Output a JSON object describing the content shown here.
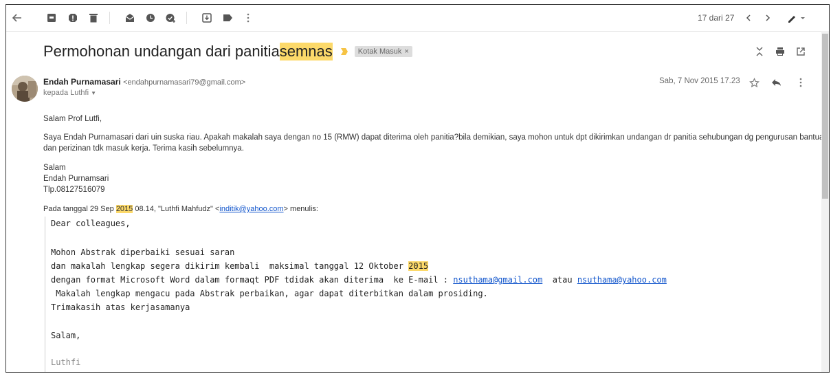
{
  "toolbar": {
    "counter": "17 dari 27",
    "icons": [
      "back-arrow-icon",
      "archive-icon",
      "report-spam-icon",
      "delete-icon",
      "mark-unread-icon",
      "snooze-icon",
      "add-task-icon",
      "move-to-icon",
      "labels-icon",
      "more-vert-icon",
      "prev-icon",
      "next-icon",
      "pen-icon"
    ]
  },
  "subject": {
    "text_before": "Permohonan undangan dari panitia ",
    "highlight": "semnas",
    "label": "Kotak Masuk",
    "label_close": "×"
  },
  "message": {
    "sender_name": "Endah Purnamasari",
    "sender_email": "<endahpurnamasari79@gmail.com>",
    "to_line": "kepada Luthfi",
    "date": "Sab, 7 Nov 2015 17.23",
    "greeting": "Salam Prof Lutfi,",
    "para1_line1": "Saya Endah Purnamasari dari uin suska riau. Apakah makalah saya dengan no 15 (RMW) dapat diterima oleh panitia?bila demikian, saya mohon untuk dpt dikirimkan undangan dr panitia sehubungan dg pengurusan bantuan",
    "para1_line2": "dan perizinan tdk masuk kerja. Terima kasih sebelumnya.",
    "sign1": "Salam",
    "sign2": "Endah Purnamsari",
    "sign3": "Tlp.08127516079"
  },
  "quote_header": {
    "before": "Pada tanggal 29 Sep ",
    "year": "2015",
    "middle": " 08.14, \"Luthfi Mahfudz\" <",
    "email": "inditik@yahoo.com",
    "after": "> menulis:"
  },
  "quote": {
    "line1": "Dear colleagues,",
    "line2": "Mohon Abstrak diperbaiki sesuai saran",
    "line3_before": "dan makalah lengkap segera dikirim kembali  maksimal tanggal 12 Oktober ",
    "line3_year": "2015",
    "line4_before": "dengan format Microsoft Word dalam formaqt PDF tdidak akan diterima  ke E-mail : ",
    "line4_email1": "nsuthama@gmail.com",
    "line4_mid": "  atau ",
    "line4_email2": "nsuthama@yahoo.com",
    "line5": " Makalah lengkap mengacu pada Abstrak perbaikan, agar dapat diterbitkan dalam prosiding.",
    "line6": "Trimakasih atas kerjasamanya",
    "line7": "Salam,",
    "line8": "Luthfi"
  }
}
